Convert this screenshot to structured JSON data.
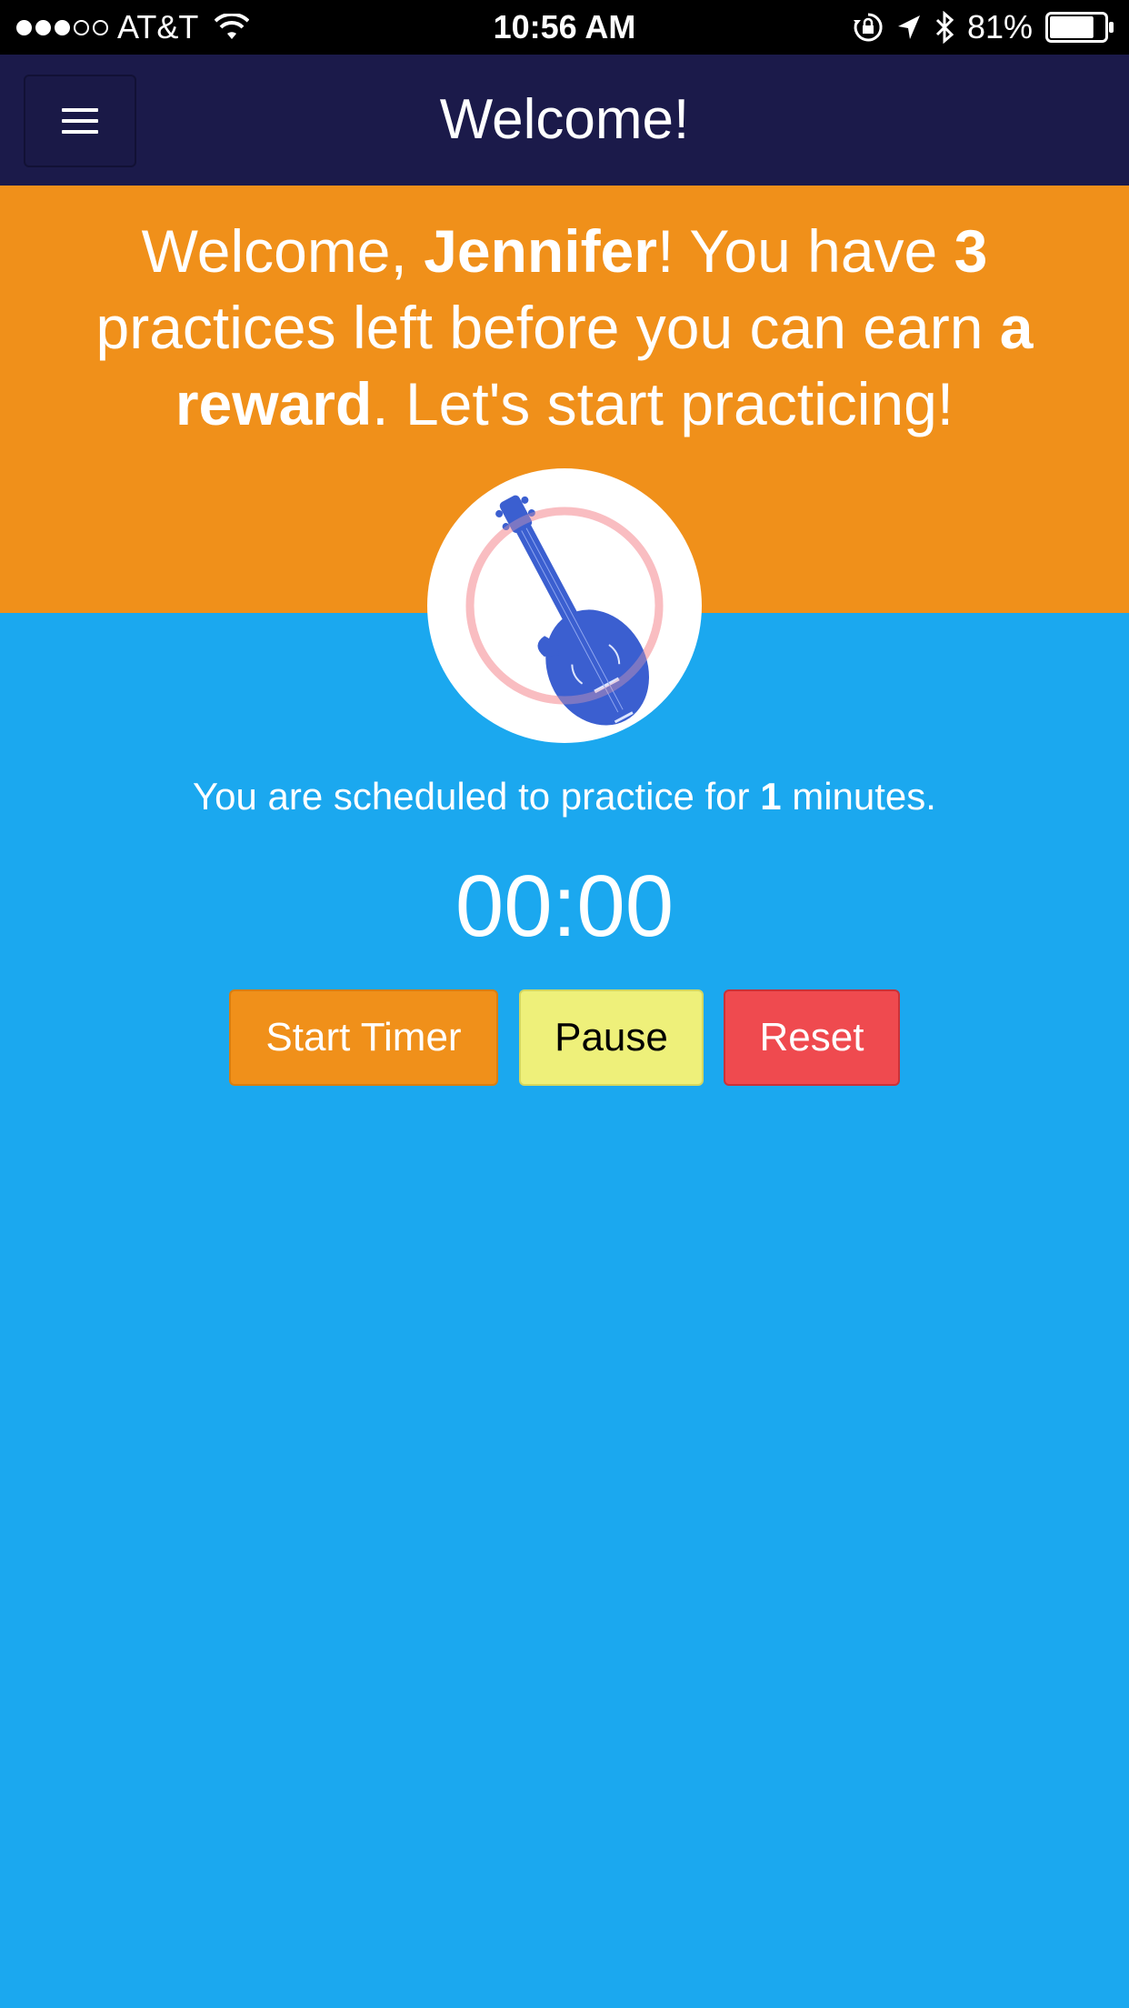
{
  "status_bar": {
    "carrier": "AT&T",
    "signal_bars_filled": 3,
    "signal_bars_total": 5,
    "time": "10:56 AM",
    "battery_percent": "81%",
    "battery_level": 0.81,
    "icons": [
      "wifi-icon",
      "rotation-lock-icon",
      "location-arrow-icon",
      "bluetooth-icon",
      "battery-icon"
    ]
  },
  "nav": {
    "title": "Welcome!",
    "menu_icon": "hamburger-icon"
  },
  "banner": {
    "part1": "Welcome, ",
    "name": "Jennifer",
    "part2": "! You have ",
    "practices_left": "3",
    "part3": " practices left before you can earn ",
    "reward": "a reward",
    "part4": ". Let's start practicing!"
  },
  "avatar": {
    "icon": "mandolin-icon"
  },
  "schedule": {
    "part1": "You are scheduled to practice for ",
    "minutes": "1",
    "part2": " minutes."
  },
  "timer": {
    "display": "00:00"
  },
  "buttons": {
    "start": "Start Timer",
    "pause": "Pause",
    "reset": "Reset"
  },
  "colors": {
    "status_bar_bg": "#000000",
    "nav_bg": "#1b1a4a",
    "banner_bg": "#f0901a",
    "page_bg": "#1ba8ef",
    "start_button": "#f0901a",
    "pause_button": "#eef07a",
    "reset_button": "#ef4a4f",
    "instrument": "#3b5fd0"
  }
}
